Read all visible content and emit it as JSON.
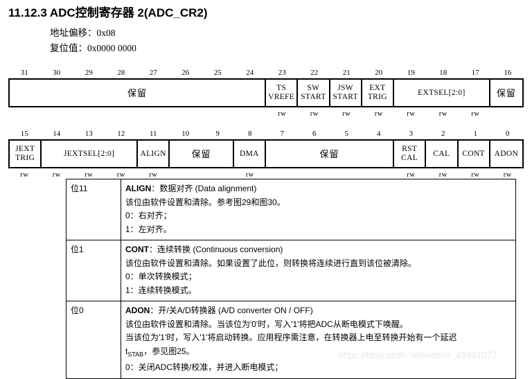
{
  "document": {
    "title": "11.12.3 ADC控制寄存器 2(ADC_CR2)",
    "address_offset": "地址偏移：0x08",
    "reset_value": "复位值：0x0000 0000",
    "watermark": "https://blog.csdn.net/weixin_43491077"
  },
  "register_high": {
    "bit_numbers": [
      "31",
      "30",
      "29",
      "28",
      "27",
      "26",
      "25",
      "24",
      "23",
      "22",
      "21",
      "20",
      "19",
      "18",
      "17",
      "16"
    ],
    "fields": [
      {
        "name": "保留",
        "line1": "保留",
        "line2": "",
        "span": 8,
        "chinese": true
      },
      {
        "name": "TSVREFE",
        "line1": "TS",
        "line2": "VREFE",
        "span": 1,
        "chinese": false
      },
      {
        "name": "SWSTART",
        "line1": "SW",
        "line2": "START",
        "span": 1,
        "chinese": false
      },
      {
        "name": "JSWSTART",
        "line1": "JSW",
        "line2": "START",
        "span": 1,
        "chinese": false
      },
      {
        "name": "EXTTRIG",
        "line1": "EXT",
        "line2": "TRIG",
        "span": 1,
        "chinese": false
      },
      {
        "name": "EXTSEL[2:0]",
        "line1": "EXTSEL[2:0]",
        "line2": "",
        "span": 3,
        "chinese": false
      },
      {
        "name": "保留",
        "line1": "保留",
        "line2": "",
        "span": 1,
        "chinese": true
      }
    ],
    "access": [
      "",
      "",
      "",
      "",
      "",
      "",
      "",
      "",
      "rw",
      "rw",
      "rw",
      "rw",
      "rw",
      "rw",
      "rw",
      ""
    ]
  },
  "register_low": {
    "bit_numbers": [
      "15",
      "14",
      "13",
      "12",
      "11",
      "10",
      "9",
      "8",
      "7",
      "6",
      "5",
      "4",
      "3",
      "2",
      "1",
      "0"
    ],
    "fields": [
      {
        "name": "JEXTTRIG",
        "line1": "JEXT",
        "line2": "TRIG",
        "span": 1,
        "chinese": false
      },
      {
        "name": "JEXTSEL[2:0]",
        "line1": "JEXTSEL[2:0]",
        "line2": "",
        "span": 3,
        "chinese": false
      },
      {
        "name": "ALIGN",
        "line1": "ALIGN",
        "line2": "",
        "span": 1,
        "chinese": false
      },
      {
        "name": "保留",
        "line1": "保留",
        "line2": "",
        "span": 2,
        "chinese": true
      },
      {
        "name": "DMA",
        "line1": "DMA",
        "line2": "",
        "span": 1,
        "chinese": false
      },
      {
        "name": "保留",
        "line1": "保留",
        "line2": "",
        "span": 4,
        "chinese": true
      },
      {
        "name": "RSTCAL",
        "line1": "RST",
        "line2": "CAL",
        "span": 1,
        "chinese": false
      },
      {
        "name": "CAL",
        "line1": "CAL",
        "line2": "",
        "span": 1,
        "chinese": false
      },
      {
        "name": "CONT",
        "line1": "CONT",
        "line2": "",
        "span": 1,
        "chinese": false
      },
      {
        "name": "ADON",
        "line1": "ADON",
        "line2": "",
        "span": 1,
        "chinese": false
      }
    ],
    "access": [
      "rw",
      "rw",
      "rw",
      "rw",
      "rw",
      "",
      "",
      "rw",
      "",
      "",
      "",
      "",
      "rw",
      "rw",
      "rw",
      "rw"
    ]
  },
  "descriptions": [
    {
      "bit": "位11",
      "heading_bold": "ALIGN",
      "heading_rest": "：数据对齐 (Data alignment)",
      "lines": [
        "该位由软件设置和清除。参考图29和图30。",
        "0：右对齐；",
        "1：左对齐。"
      ]
    },
    {
      "bit": "位1",
      "heading_bold": "CONT",
      "heading_rest": "：连续转换 (Continuous conversion)",
      "lines": [
        "该位由软件设置和清除。如果设置了此位，则转换将连续进行直到该位被清除。",
        "0：单次转换模式；",
        "1：连续转换模式。"
      ]
    },
    {
      "bit": "位0",
      "heading_bold": "ADON",
      "heading_rest": "：开/关A/D转换器 (A/D converter ON / OFF)",
      "lines": [
        "该位由软件设置和清除。当该位为'0'时，写入'1'将把ADC从断电模式下唤醒。",
        "当该位为'1'时，写入'1'将启动转换。应用程序需注意，在转换器上电至转换开始有一个延迟",
        "t(STAB)，参见图25。",
        "0：关闭ADC转换/校准，并进入断电模式；"
      ]
    }
  ]
}
